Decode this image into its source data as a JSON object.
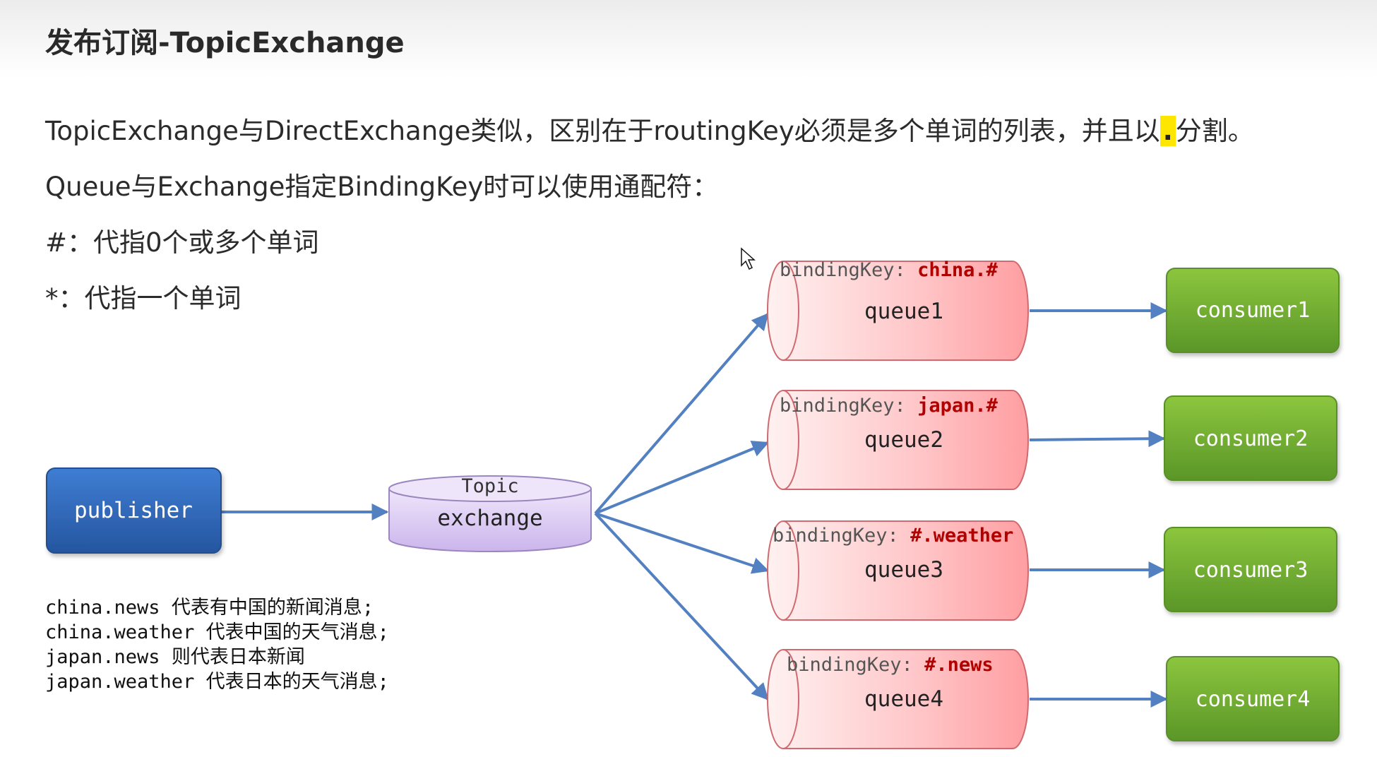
{
  "slide": {
    "title": "发布订阅-TopicExchange",
    "line1_before": "TopicExchange与DirectExchange类似，区别在于routingKey必须是多个单词的列表，并且以",
    "line1_dot": ".",
    "line1_after": "分割。",
    "line2": "Queue与Exchange指定BindingKey时可以使用通配符：",
    "line3": "#：代指0个或多个单词",
    "line4": "*：代指一个单词"
  },
  "diagram": {
    "publisher": "publisher",
    "exchange": {
      "type": "Topic",
      "name": "exchange"
    },
    "binding_prefix": "bindingKey: ",
    "queues": [
      {
        "name": "queue1",
        "binding_key": "china.#",
        "consumer": "consumer1"
      },
      {
        "name": "queue2",
        "binding_key": "japan.#",
        "consumer": "consumer2"
      },
      {
        "name": "queue3",
        "binding_key": "#.weather",
        "consumer": "consumer3"
      },
      {
        "name": "queue4",
        "binding_key": "#.news",
        "consumer": "consumer4"
      }
    ],
    "colors": {
      "publisher": "#2f64b4",
      "exchange": "#d9c8f2",
      "queue": "#ffb3b6",
      "consumer": "#6fad32",
      "arrow": "#5280c0",
      "binding_key": "#b00000"
    }
  },
  "notes": [
    {
      "key": "china.news",
      "desc": "代表有中国的新闻消息;"
    },
    {
      "key": "china.weather",
      "desc": "代表中国的天气消息;"
    },
    {
      "key": "japan.news",
      "desc": "则代表日本新闻"
    },
    {
      "key": "japan.weather",
      "desc": "代表日本的天气消息;"
    }
  ]
}
